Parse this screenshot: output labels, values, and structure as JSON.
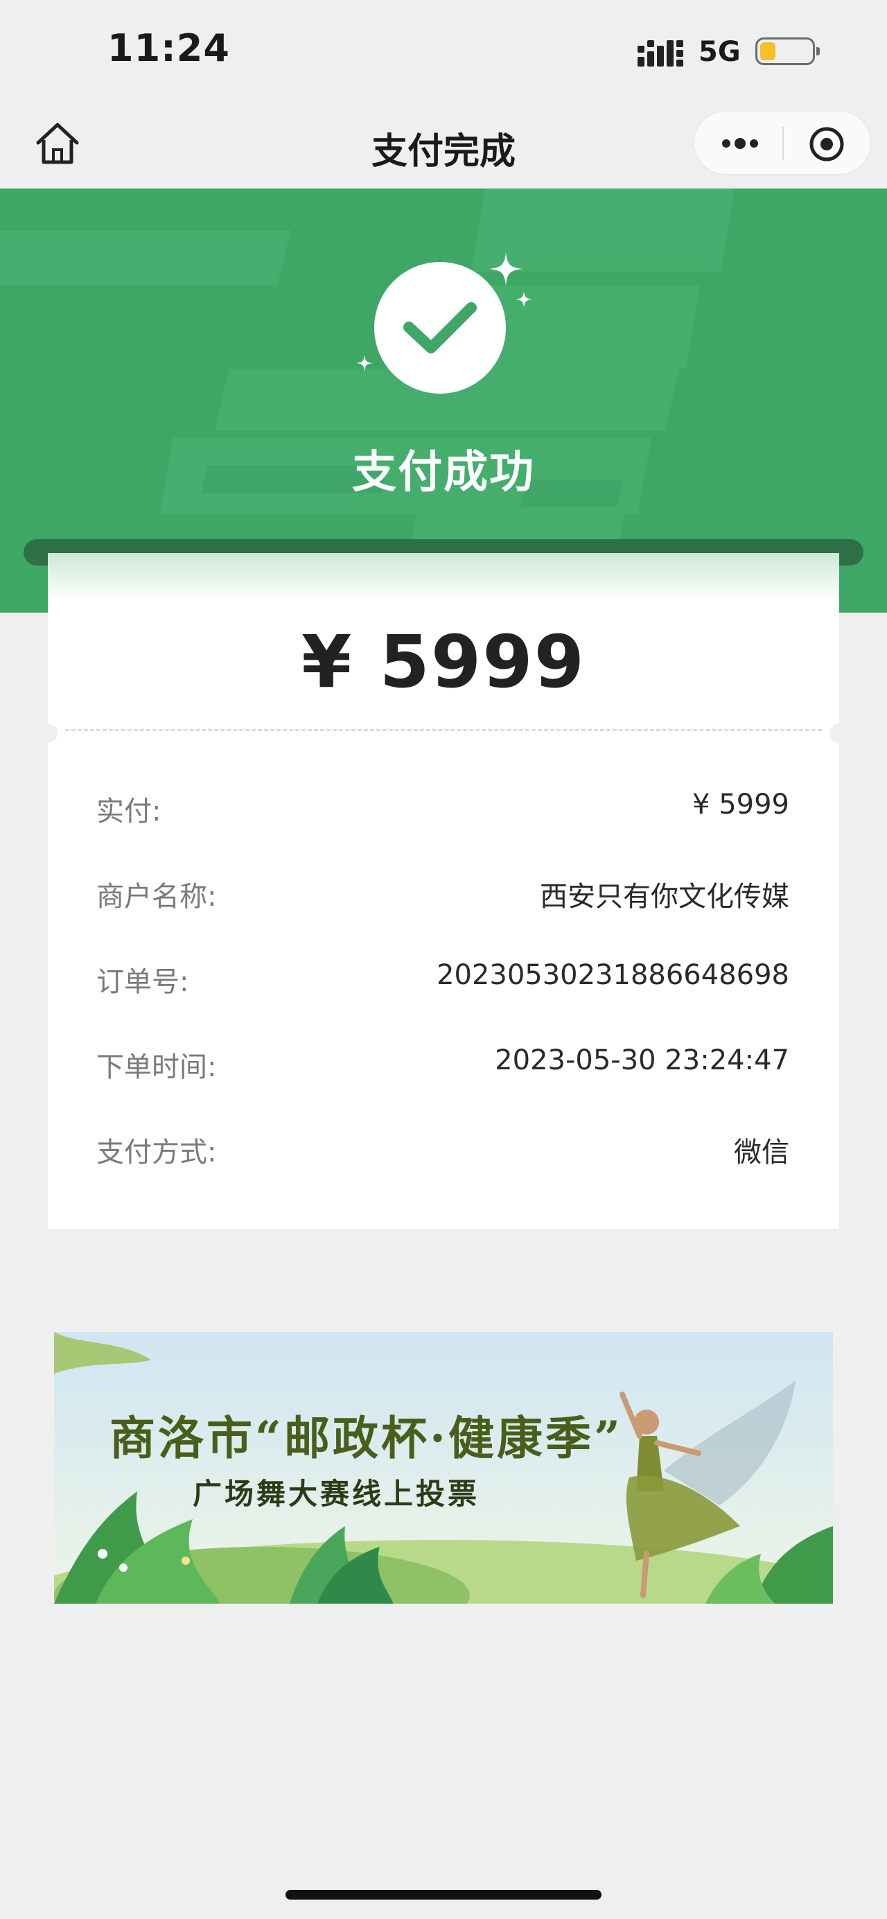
{
  "status_bar": {
    "time": "11:24",
    "network": "5G",
    "battery_level": 0.3
  },
  "nav": {
    "title": "支付完成"
  },
  "hero": {
    "title": "支付成功"
  },
  "receipt": {
    "amount": "¥ 5999",
    "rows": [
      {
        "label": "实付:",
        "value": "¥ 5999"
      },
      {
        "label": "商户名称:",
        "value": "西安只有你文化传媒"
      },
      {
        "label": "订单号:",
        "value": "2023053023188664869­8"
      },
      {
        "label": "下单时间:",
        "value": "2023-05-30 23:24:47"
      },
      {
        "label": "支付方式:",
        "value": "微信"
      }
    ]
  },
  "banner": {
    "title": "商洛市“邮政杯·健康季”",
    "subtitle": "广场舞大赛线上投票"
  },
  "colors": {
    "brand_green": "#3ea766",
    "slot_green": "#2f6f46",
    "background": "#efefef"
  },
  "icons": [
    "home-icon",
    "more-icon",
    "target-icon",
    "checkmark-icon",
    "sparkle-icon",
    "signal-icon",
    "battery-icon"
  ]
}
